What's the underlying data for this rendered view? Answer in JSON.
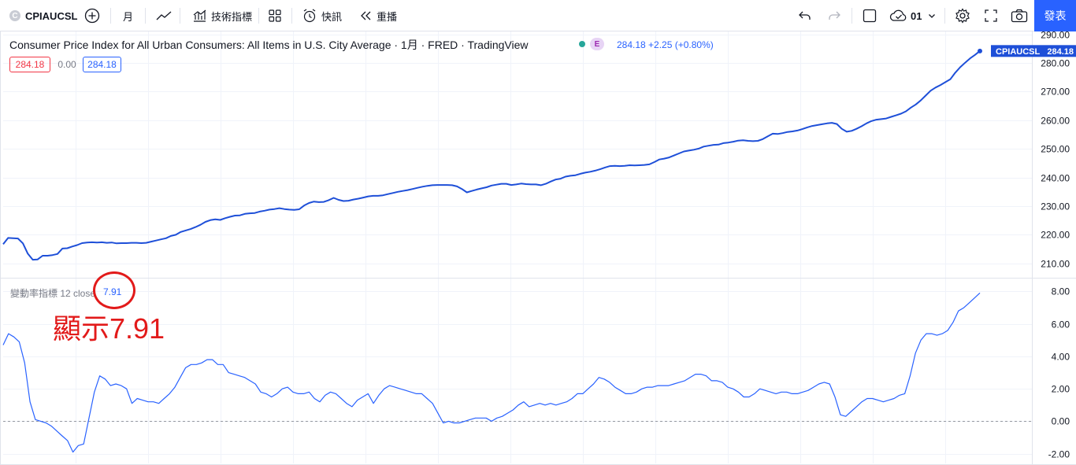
{
  "toolbar": {
    "symbol": "CPIAUCSL",
    "symbol_icon": "C",
    "interval": "月",
    "indicators_label": "技術指標",
    "alert_label": "快訊",
    "replay_label": "重播",
    "layout_label": "01",
    "publish_label": "發表"
  },
  "legend": {
    "title": "Consumer Price Index for All Urban Consumers: All Items in U.S. City Average · 1月 · FRED · TradingView",
    "badge_e": "E",
    "price_change": "284.18 +2.25 (+0.80%)",
    "ohlc_open": "284.18",
    "ohlc_mid": "0.00",
    "ohlc_close": "284.18"
  },
  "indicator": {
    "label": "變動率指標 12 close",
    "value": "7.91"
  },
  "annotation": {
    "text": "顯示7.91"
  },
  "chart_data": [
    {
      "type": "line",
      "title": "Consumer Price Index for All Urban Consumers: All Items in U.S. City Average",
      "series": [
        {
          "name": "CPIAUCSL",
          "color": "#1e4fd8",
          "values": [
            216.7,
            218.9,
            218.8,
            218.7,
            217.0,
            213.4,
            211.3,
            211.4,
            212.7,
            212.7,
            212.9,
            213.3,
            215.2,
            215.3,
            215.9,
            216.4,
            217.1,
            217.3,
            217.4,
            217.3,
            217.4,
            217.2,
            217.3,
            217.0,
            217.1,
            217.1,
            217.2,
            217.2,
            217.1,
            217.2,
            217.6,
            218.0,
            218.4,
            218.8,
            219.6,
            220.0,
            221.0,
            221.5,
            222.0,
            222.7,
            223.5,
            224.5,
            225.1,
            225.4,
            225.2,
            225.8,
            226.3,
            226.7,
            226.8,
            227.3,
            227.5,
            227.6,
            228.1,
            228.4,
            228.8,
            229.0,
            229.3,
            229.0,
            228.8,
            228.7,
            228.9,
            230.2,
            231.1,
            231.6,
            231.4,
            231.5,
            232.1,
            232.9,
            232.2,
            231.8,
            231.9,
            232.3,
            232.6,
            233.0,
            233.4,
            233.6,
            233.6,
            233.8,
            234.2,
            234.6,
            235.0,
            235.3,
            235.6,
            236.0,
            236.4,
            236.8,
            237.1,
            237.3,
            237.4,
            237.4,
            237.4,
            237.3,
            236.9,
            236.0,
            234.8,
            235.3,
            235.8,
            236.2,
            236.6,
            237.2,
            237.5,
            237.8,
            237.8,
            237.4,
            237.6,
            237.9,
            237.7,
            237.6,
            237.6,
            237.3,
            237.8,
            238.6,
            239.3,
            239.6,
            240.3,
            240.6,
            240.8,
            241.3,
            241.7,
            242.0,
            242.4,
            242.9,
            243.5,
            244.0,
            244.1,
            244.0,
            244.1,
            244.3,
            244.2,
            244.3,
            244.4,
            244.6,
            245.4,
            246.3,
            246.6,
            247.0,
            247.7,
            248.4,
            249.1,
            249.4,
            249.7,
            250.1,
            250.8,
            251.1,
            251.4,
            251.5,
            252.0,
            252.2,
            252.5,
            252.9,
            253.0,
            252.8,
            252.7,
            252.8,
            253.4,
            254.4,
            255.3,
            255.2,
            255.5,
            255.9,
            256.1,
            256.4,
            256.9,
            257.5,
            258.0,
            258.3,
            258.6,
            258.9,
            259.1,
            258.7,
            257.0,
            256.0,
            256.3,
            257.0,
            257.9,
            258.9,
            259.7,
            260.2,
            260.4,
            260.6,
            261.2,
            261.7,
            262.3,
            263.1,
            264.4,
            265.5,
            266.9,
            268.6,
            270.3,
            271.4,
            272.3,
            273.3,
            274.3,
            276.6,
            278.5,
            280.1,
            281.6,
            282.8,
            284.18
          ]
        }
      ],
      "ylim": [
        205,
        291
      ],
      "yticks": [
        210,
        220,
        230,
        240,
        250,
        260,
        270,
        280,
        290
      ],
      "last_value_label": "284.18",
      "grid": true
    },
    {
      "type": "line",
      "title": "變動率指標 12 close",
      "series": [
        {
          "name": "ROC",
          "color": "#2962ff",
          "values": [
            4.7,
            5.4,
            5.2,
            4.9,
            3.6,
            1.2,
            0.1,
            0.0,
            -0.1,
            -0.3,
            -0.6,
            -0.9,
            -1.2,
            -1.9,
            -1.5,
            -1.4,
            0.2,
            1.8,
            2.8,
            2.6,
            2.2,
            2.3,
            2.2,
            2.0,
            1.1,
            1.4,
            1.3,
            1.2,
            1.2,
            1.1,
            1.4,
            1.7,
            2.1,
            2.7,
            3.3,
            3.5,
            3.5,
            3.6,
            3.8,
            3.8,
            3.5,
            3.5,
            3.0,
            2.9,
            2.8,
            2.7,
            2.5,
            2.3,
            1.8,
            1.7,
            1.5,
            1.7,
            2.0,
            2.1,
            1.8,
            1.7,
            1.7,
            1.8,
            1.4,
            1.2,
            1.6,
            1.8,
            1.7,
            1.4,
            1.1,
            0.9,
            1.3,
            1.5,
            1.7,
            1.1,
            1.6,
            2.0,
            2.2,
            2.1,
            2.0,
            1.9,
            1.8,
            1.7,
            1.7,
            1.4,
            1.1,
            0.5,
            -0.1,
            0.0,
            -0.1,
            -0.1,
            0.0,
            0.1,
            0.2,
            0.2,
            0.2,
            0.0,
            0.2,
            0.3,
            0.5,
            0.7,
            1.0,
            1.2,
            0.9,
            1.0,
            1.1,
            1.0,
            1.1,
            1.0,
            1.1,
            1.2,
            1.4,
            1.7,
            1.7,
            2.0,
            2.3,
            2.7,
            2.6,
            2.4,
            2.1,
            1.9,
            1.7,
            1.7,
            1.8,
            2.0,
            2.1,
            2.1,
            2.2,
            2.2,
            2.2,
            2.3,
            2.4,
            2.5,
            2.7,
            2.9,
            2.9,
            2.8,
            2.5,
            2.5,
            2.4,
            2.1,
            2.0,
            1.8,
            1.5,
            1.5,
            1.7,
            2.0,
            1.9,
            1.8,
            1.7,
            1.8,
            1.8,
            1.7,
            1.7,
            1.8,
            1.9,
            2.1,
            2.3,
            2.4,
            2.3,
            1.5,
            0.4,
            0.3,
            0.6,
            0.9,
            1.2,
            1.4,
            1.4,
            1.3,
            1.2,
            1.3,
            1.4,
            1.6,
            1.7,
            2.8,
            4.2,
            5.0,
            5.4,
            5.4,
            5.3,
            5.4,
            5.6,
            6.1,
            6.8,
            7.0,
            7.3,
            7.6,
            7.91
          ]
        }
      ],
      "ylim": [
        -2.6,
        8.8
      ],
      "yticks": [
        -2,
        0,
        2,
        4,
        6,
        8
      ],
      "baseline": 0,
      "grid": true
    }
  ]
}
